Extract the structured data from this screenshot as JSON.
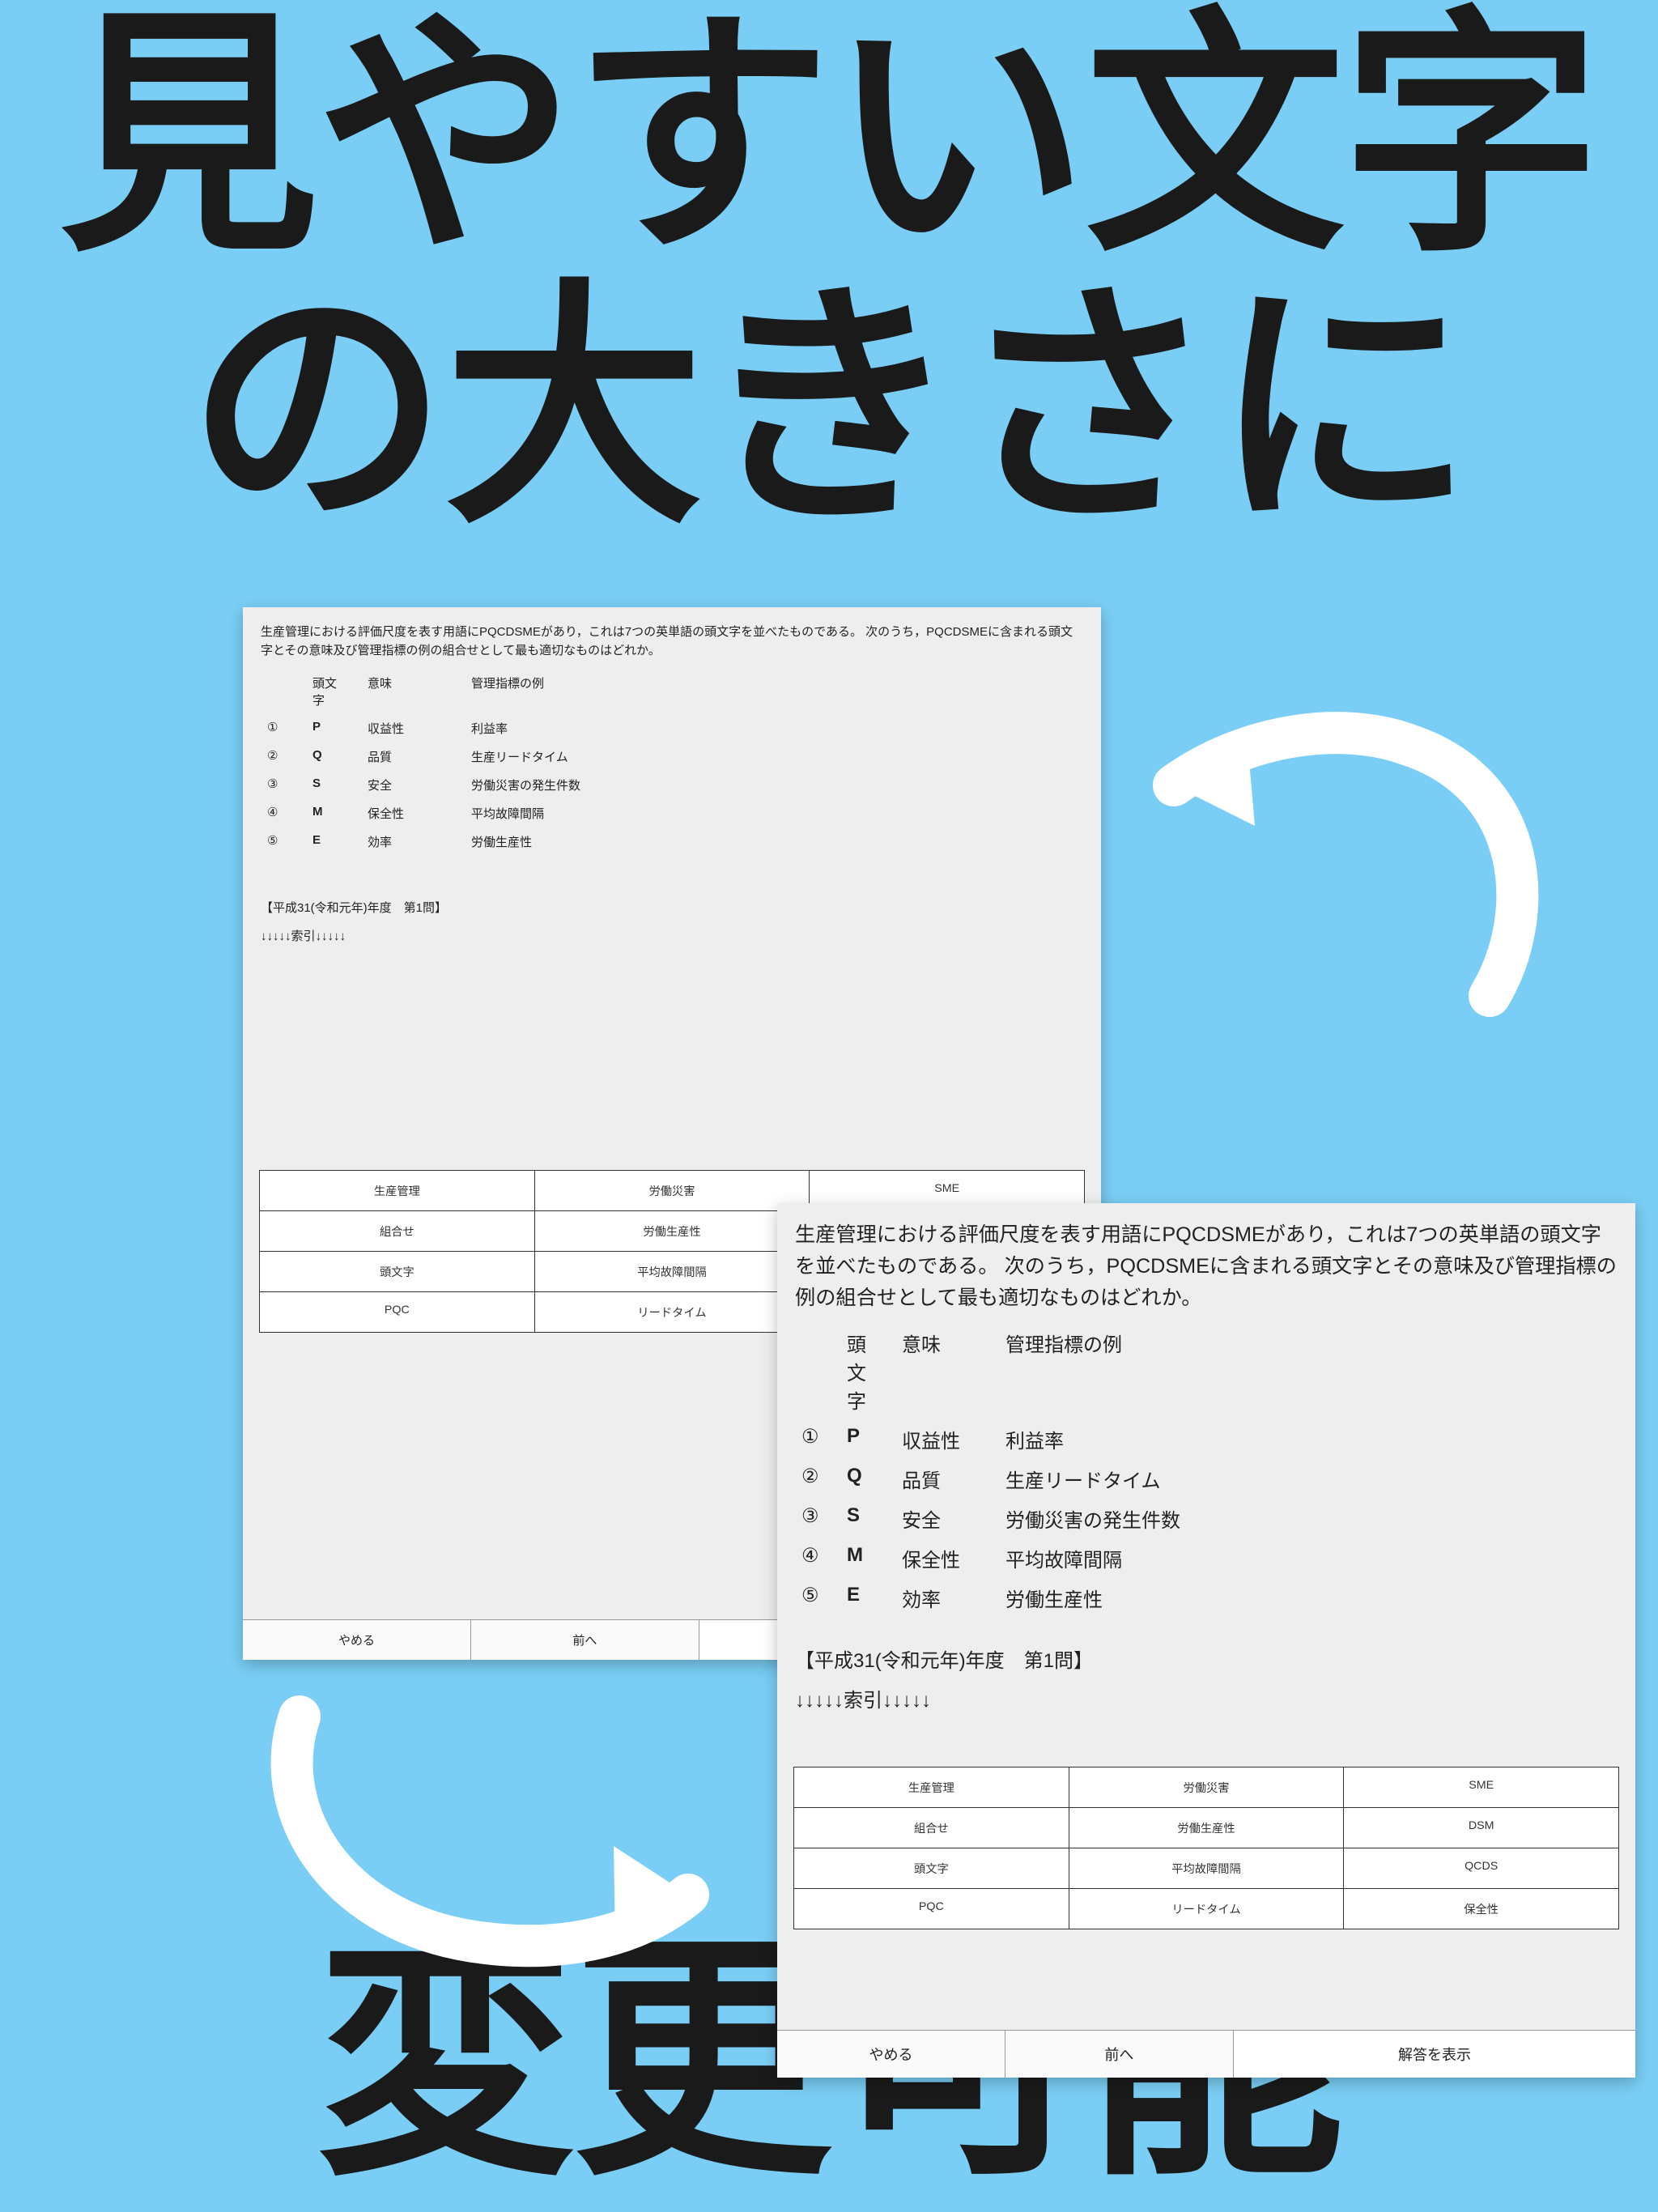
{
  "headline": {
    "top_line1": "見やすい文字",
    "top_line2": "の大きさに",
    "bottom": "変更可能"
  },
  "question": {
    "text": "生産管理における評価尺度を表す用語にPQCDSMEがあり，これは7つの英単語の頭文字を並べたものである。 次のうち，PQCDSMEに含まれる頭文字とその意味及び管理指標の例の組合せとして最も適切なものはどれか。",
    "header": {
      "letter": "頭文字",
      "meaning": "意味",
      "example": "管理指標の例"
    },
    "options": [
      {
        "num": "①",
        "letter": "P",
        "meaning": "収益性",
        "example": "利益率"
      },
      {
        "num": "②",
        "letter": "Q",
        "meaning": "品質",
        "example": "生産リードタイム"
      },
      {
        "num": "③",
        "letter": "S",
        "meaning": "安全",
        "example": "労働災害の発生件数"
      },
      {
        "num": "④",
        "letter": "M",
        "meaning": "保全性",
        "example": "平均故障間隔"
      },
      {
        "num": "⑤",
        "letter": "E",
        "meaning": "効率",
        "example": "労働生産性"
      }
    ],
    "source": "【平成31(令和元年)年度　第1問】",
    "index_marker": "↓↓↓↓↓索引↓↓↓↓↓"
  },
  "tag_grid": [
    [
      "生産管理",
      "労働災害",
      "SME"
    ],
    [
      "組合せ",
      "労働生産性",
      "DSM"
    ],
    [
      "頭文字",
      "平均故障間隔",
      "QCDS"
    ],
    [
      "PQC",
      "リードタイム",
      "保全性"
    ]
  ],
  "buttons": {
    "quit": "やめる",
    "prev": "前へ",
    "show_answer": "解答を表示"
  }
}
